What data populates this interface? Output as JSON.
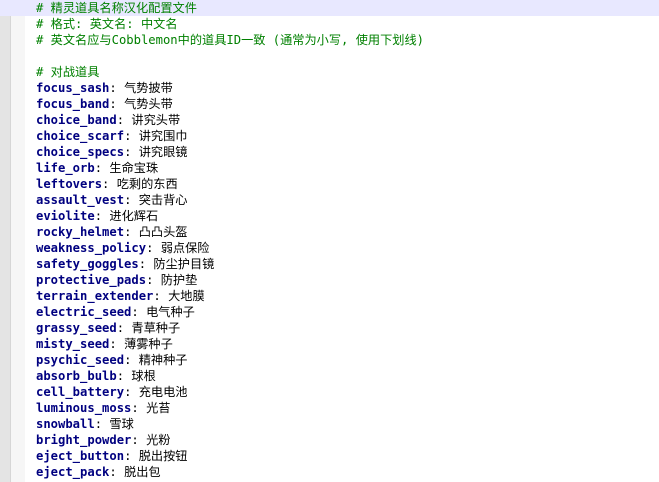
{
  "colors": {
    "comment": "#008000",
    "key": "#000080",
    "current_line": "#e8e8ff"
  },
  "comments": [
    "# 精灵道具名称汉化配置文件",
    "# 格式: 英文名: 中文名",
    "# 英文名应与Cobblemon中的道具ID一致 (通常为小写, 使用下划线)"
  ],
  "section_title": "# 对战道具",
  "items": [
    {
      "key": "focus_sash",
      "value": "气势披带"
    },
    {
      "key": "focus_band",
      "value": "气势头带"
    },
    {
      "key": "choice_band",
      "value": "讲究头带"
    },
    {
      "key": "choice_scarf",
      "value": "讲究围巾"
    },
    {
      "key": "choice_specs",
      "value": "讲究眼镜"
    },
    {
      "key": "life_orb",
      "value": "生命宝珠"
    },
    {
      "key": "leftovers",
      "value": "吃剩的东西"
    },
    {
      "key": "assault_vest",
      "value": "突击背心"
    },
    {
      "key": "eviolite",
      "value": "进化辉石"
    },
    {
      "key": "rocky_helmet",
      "value": "凸凸头盔"
    },
    {
      "key": "weakness_policy",
      "value": "弱点保险"
    },
    {
      "key": "safety_goggles",
      "value": "防尘护目镜"
    },
    {
      "key": "protective_pads",
      "value": "防护垫"
    },
    {
      "key": "terrain_extender",
      "value": "大地膜"
    },
    {
      "key": "electric_seed",
      "value": "电气种子"
    },
    {
      "key": "grassy_seed",
      "value": "青草种子"
    },
    {
      "key": "misty_seed",
      "value": "薄雾种子"
    },
    {
      "key": "psychic_seed",
      "value": "精神种子"
    },
    {
      "key": "absorb_bulb",
      "value": "球根"
    },
    {
      "key": "cell_battery",
      "value": "充电电池"
    },
    {
      "key": "luminous_moss",
      "value": "光苔"
    },
    {
      "key": "snowball",
      "value": "雪球"
    },
    {
      "key": "bright_powder",
      "value": "光粉"
    },
    {
      "key": "eject_button",
      "value": "脱出按钮"
    },
    {
      "key": "eject_pack",
      "value": "脱出包"
    }
  ]
}
